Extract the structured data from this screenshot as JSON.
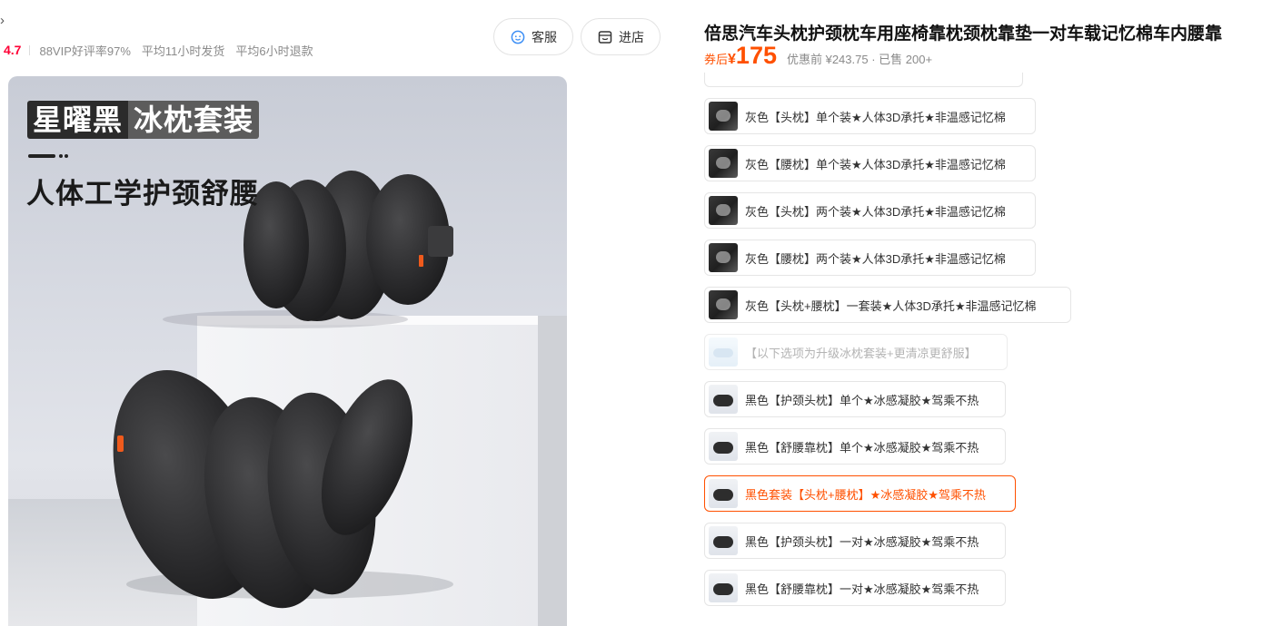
{
  "nav": {
    "back_arrow": "›"
  },
  "store_stats": {
    "score": "4.7",
    "items": [
      "88VIP好评率97%",
      "平均11小时发货",
      "平均6小时退款"
    ]
  },
  "actions": {
    "service_label": "客服",
    "service_icon": "headset-icon",
    "store_label": "进店",
    "store_icon": "store-icon"
  },
  "hero": {
    "tag_dark": "星曜黑",
    "tag_light": "冰枕套装",
    "headline": "人体工学护颈舒腰"
  },
  "product": {
    "title": "倍思汽车头枕护颈枕车用座椅靠枕颈枕靠垫一对车载记忆棉车内腰靠",
    "price_label": "券后",
    "currency": "¥",
    "price": "175",
    "pre_price_text": "优惠前 ¥243.75 · 已售 200+"
  },
  "skus": [
    {
      "label": "灰色【头枕】单个装★人体3D承托★非温感记忆棉",
      "thumb": "dark",
      "state": "normal"
    },
    {
      "label": "灰色【腰枕】单个装★人体3D承托★非温感记忆棉",
      "thumb": "dark",
      "state": "normal"
    },
    {
      "label": "灰色【头枕】两个装★人体3D承托★非温感记忆棉",
      "thumb": "dark",
      "state": "normal"
    },
    {
      "label": "灰色【腰枕】两个装★人体3D承托★非温感记忆棉",
      "thumb": "dark",
      "state": "normal"
    },
    {
      "label": "灰色【头枕+腰枕】一套装★人体3D承托★非温感记忆棉",
      "thumb": "dark",
      "state": "normal"
    },
    {
      "label": "【以下选项为升级冰枕套装+更清凉更舒服】",
      "thumb": "ice",
      "state": "disabled"
    },
    {
      "label": "黑色【护颈头枕】单个★冰感凝胶★驾乘不热",
      "thumb": "light",
      "state": "normal"
    },
    {
      "label": "黑色【舒腰靠枕】单个★冰感凝胶★驾乘不热",
      "thumb": "light",
      "state": "normal"
    },
    {
      "label": "黑色套装【头枕+腰枕】★冰感凝胶★驾乘不热",
      "thumb": "light",
      "state": "selected"
    },
    {
      "label": "黑色【护颈头枕】一对★冰感凝胶★驾乘不热",
      "thumb": "light",
      "state": "normal"
    },
    {
      "label": "黑色【舒腰靠枕】一对★冰感凝胶★驾乘不热",
      "thumb": "light",
      "state": "normal"
    }
  ],
  "colors": {
    "accent": "#ff5000",
    "score": "#ff0036",
    "service_icon": "#3d8ff5"
  }
}
